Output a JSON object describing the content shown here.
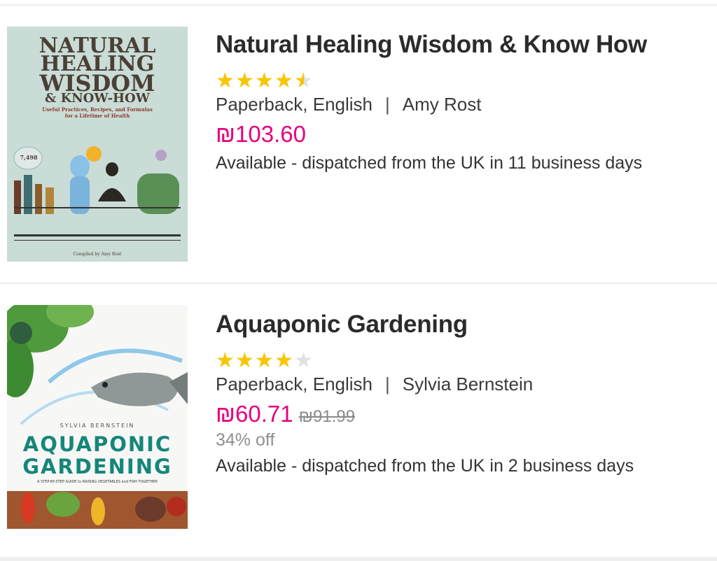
{
  "products": [
    {
      "title": "Natural Healing Wisdom & Know How",
      "rating": 4.5,
      "format": "Paperback, English",
      "separator": "|",
      "author": "Amy Rost",
      "price": "₪103.60",
      "availability": "Available - dispatched from the UK in 11 business days",
      "cover": {
        "lines": [
          "NATURAL",
          "HEALING",
          "WISDOM",
          "& KNOW-HOW"
        ],
        "subtitle": "Useful Practices, Recipes, and Formulas for a Lifetime of Health",
        "badge": "7,498",
        "footer": "Compiled by Amy Rost",
        "colors": {
          "background": "#c9dcd6",
          "ink": "#4b3f36"
        }
      }
    },
    {
      "title": "Aquaponic Gardening",
      "rating": 4,
      "format": "Paperback, English",
      "separator": "|",
      "author": "Sylvia Bernstein",
      "price": "₪60.71",
      "old_price": "₪91.99",
      "discount": "34% off",
      "availability": "Available - dispatched from the UK in 2 business days",
      "cover": {
        "author": "SYLVIA BERNSTEIN",
        "lines": [
          "AQUAPONIC",
          "GARDENING"
        ],
        "tagline": "A STEP-BY-STEP GUIDE to RAISING VEGETABLES and FISH TOGETHER",
        "colors": {
          "background": "#f7f8f6",
          "ink": "#15867a"
        }
      }
    }
  ],
  "colors": {
    "price": "#e6007e",
    "star": "#f9c500",
    "star_empty": "#e0e0e0"
  }
}
